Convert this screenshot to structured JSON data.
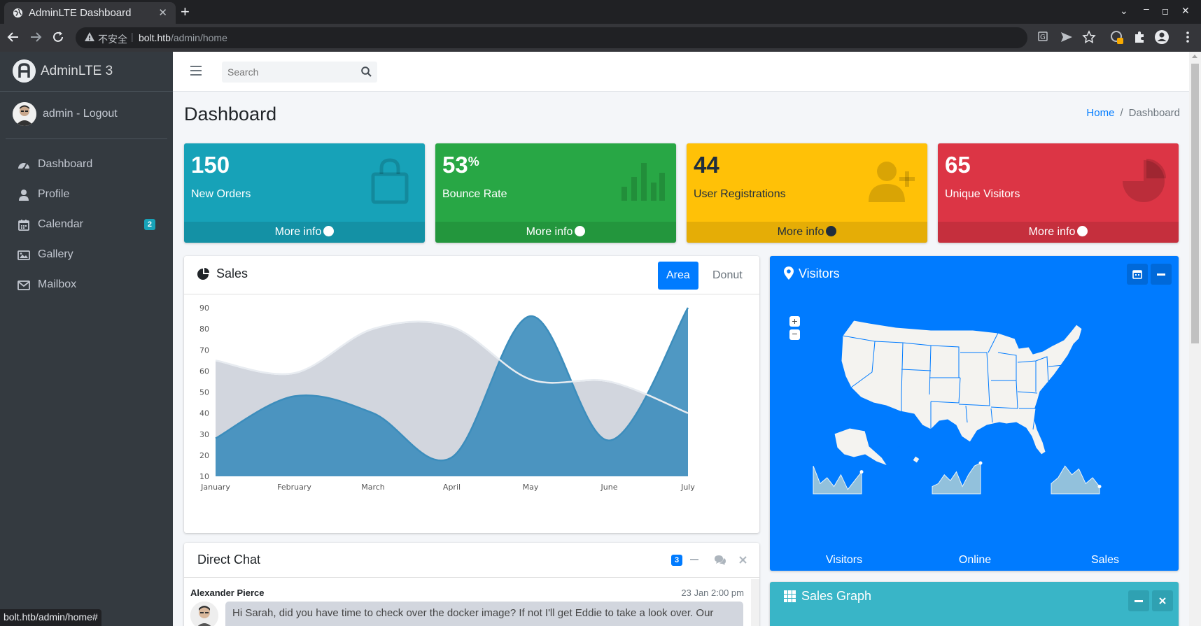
{
  "browser": {
    "tab_title": "AdminLTE Dashboard",
    "insecure_label": "不安全",
    "url_host": "bolt.htb",
    "url_path": "/admin/home",
    "status_url": "bolt.htb/admin/home#"
  },
  "sidebar": {
    "brand": "AdminLTE 3",
    "user": "admin - Logout",
    "items": [
      {
        "label": "Dashboard",
        "icon": "tachometer-icon"
      },
      {
        "label": "Profile",
        "icon": "user-icon"
      },
      {
        "label": "Calendar",
        "icon": "calendar-icon",
        "badge": "2"
      },
      {
        "label": "Gallery",
        "icon": "image-icon"
      },
      {
        "label": "Mailbox",
        "icon": "envelope-icon"
      }
    ]
  },
  "topbar": {
    "search_placeholder": "Search"
  },
  "header": {
    "title": "Dashboard",
    "breadcrumb_home": "Home",
    "breadcrumb_current": "Dashboard"
  },
  "boxes": [
    {
      "value": "150",
      "label": "New Orders",
      "more": "More info",
      "color": "#17a2b8"
    },
    {
      "value": "53",
      "sup": "%",
      "label": "Bounce Rate",
      "more": "More info",
      "color": "#28a745"
    },
    {
      "value": "44",
      "label": "User Registrations",
      "more": "More info",
      "color": "#ffc107"
    },
    {
      "value": "65",
      "label": "Unique Visitors",
      "more": "More info",
      "color": "#dc3545"
    }
  ],
  "sales": {
    "title": "Sales",
    "tab_area": "Area",
    "tab_donut": "Donut"
  },
  "chart_data": {
    "type": "area",
    "categories": [
      "January",
      "February",
      "March",
      "April",
      "May",
      "June",
      "July"
    ],
    "ylim": [
      10,
      90
    ],
    "yticks": [
      10,
      20,
      30,
      40,
      50,
      60,
      70,
      80,
      90
    ],
    "grid": false,
    "series": [
      {
        "name": "",
        "color": "#d2d6de",
        "values": [
          65,
          59,
          80,
          81,
          56,
          55,
          40
        ]
      },
      {
        "name": "",
        "color": "#3c8dbc",
        "values": [
          28,
          48,
          40,
          19,
          86,
          27,
          90
        ]
      }
    ]
  },
  "visitors": {
    "title": "Visitors",
    "zoom_in": "+",
    "zoom_out": "−",
    "sparks": [
      {
        "label": "Visitors",
        "values": [
          0.9,
          0.3,
          0.5,
          0.2,
          0.6,
          0.1,
          0.4,
          0.7
        ]
      },
      {
        "label": "Online",
        "values": [
          0.2,
          0.3,
          0.6,
          0.4,
          0.7,
          0.2,
          0.6,
          0.9,
          1.0
        ]
      },
      {
        "label": "Sales",
        "values": [
          0.3,
          0.5,
          0.9,
          0.6,
          0.8,
          0.3,
          0.5,
          0.2
        ]
      }
    ]
  },
  "chat": {
    "title": "Direct Chat",
    "badge": "3",
    "name": "Alexander Pierce",
    "time": "23 Jan 2:00 pm",
    "message": "Hi Sarah, did you have time to check over the docker image? If not I'll get Eddie to take a look over. Our"
  },
  "sales_graph": {
    "title": "Sales Graph"
  }
}
